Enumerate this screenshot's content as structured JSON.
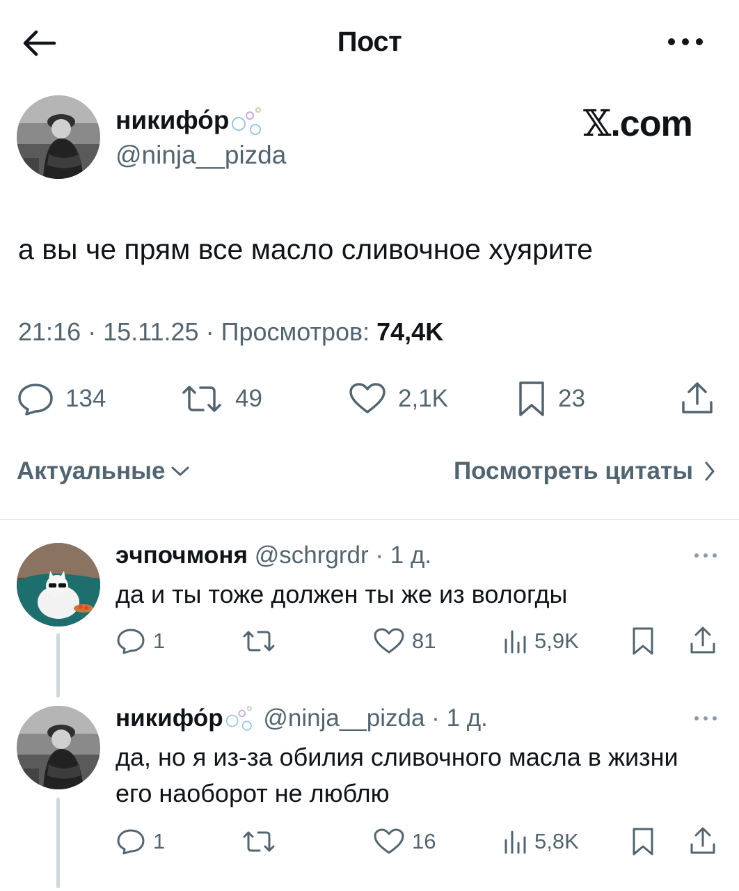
{
  "header": {
    "title": "Пост"
  },
  "post": {
    "author_name": "никифо́р",
    "author_handle": "@ninja__pizda",
    "brand": "X.com",
    "brand_glyph": "𝕏",
    "brand_suffix": ".com",
    "text": "а вы че прям все масло сливочное хуярите",
    "time": "21:16",
    "date": "15.11.25",
    "views_label": "Просмотров:",
    "views_value": "74,4K",
    "stats": {
      "replies": "134",
      "reposts": "49",
      "likes": "2,1K",
      "bookmarks": "23"
    }
  },
  "controls": {
    "sort_label": "Актуальные",
    "quotes_label": "Посмотреть цитаты"
  },
  "replies": [
    {
      "name": "эчпочмоня",
      "handle": "@schrgrdr",
      "age": "1 д.",
      "text": "да и ты тоже должен ты же из вологды",
      "stats": {
        "replies": "1",
        "reposts": "",
        "likes": "81",
        "views": "5,9K"
      }
    },
    {
      "name": "никифо́р",
      "handle": "@ninja__pizda",
      "age": "1 д.",
      "text": "да, но я из-за обилия сливочного масла в жизни его наоборот не люблю",
      "stats": {
        "replies": "1",
        "reposts": "",
        "likes": "16",
        "views": "5,8K"
      }
    }
  ],
  "colors": {
    "text": "#0f1419",
    "secondary": "#536471",
    "divider": "#e1e6ea",
    "thread_line": "#cfd9de"
  }
}
